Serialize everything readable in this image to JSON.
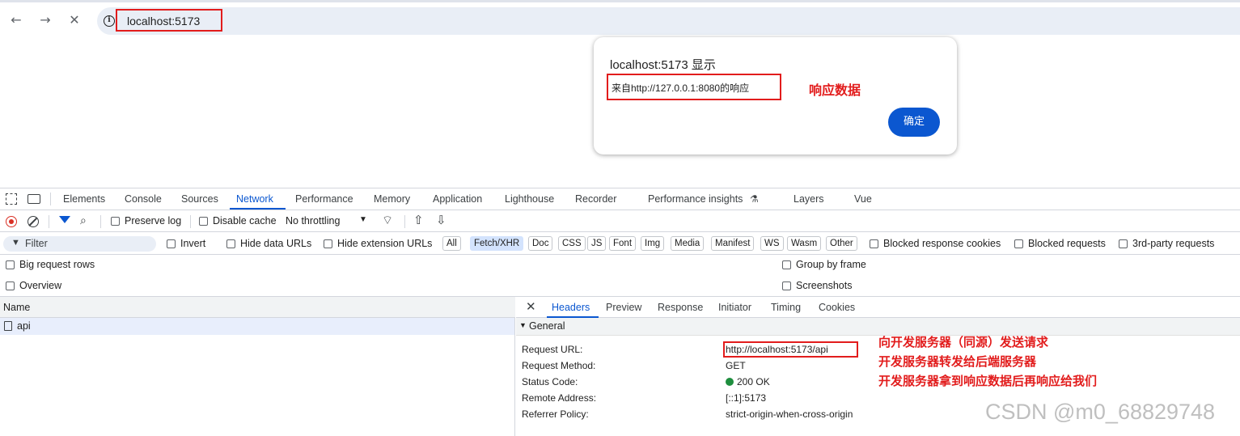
{
  "browser": {
    "url": "localhost:5173",
    "nav": {
      "back": "←",
      "forward": "→",
      "stop": "✕"
    }
  },
  "dialog": {
    "title": "localhost:5173 显示",
    "message": "来自http://127.0.0.1:8080的响应",
    "ok_label": "确定",
    "annotation": "响应数据"
  },
  "devtools": {
    "tabs": [
      "Elements",
      "Console",
      "Sources",
      "Network",
      "Performance",
      "Memory",
      "Application",
      "Lighthouse",
      "Recorder",
      "Performance insights",
      "Layers",
      "Vue"
    ],
    "active_tab": "Network",
    "toolbar": {
      "preserve_log": "Preserve log",
      "disable_cache": "Disable cache",
      "throttling": "No throttling"
    },
    "filter": {
      "placeholder": "Filter",
      "invert": "Invert",
      "hide_data_urls": "Hide data URLs",
      "hide_extension_urls": "Hide extension URLs",
      "chips": [
        "All",
        "Fetch/XHR",
        "Doc",
        "CSS",
        "JS",
        "Font",
        "Img",
        "Media",
        "Manifest",
        "WS",
        "Wasm",
        "Other"
      ],
      "active_chip": "Fetch/XHR",
      "blocked_response_cookies": "Blocked response cookies",
      "blocked_requests": "Blocked requests",
      "third_party": "3rd-party requests"
    },
    "options": {
      "big_request_rows": "Big request rows",
      "overview": "Overview",
      "group_by_frame": "Group by frame",
      "screenshots": "Screenshots"
    },
    "request_list": {
      "header": "Name",
      "rows": [
        "api"
      ]
    },
    "detail": {
      "tabs": [
        "Headers",
        "Preview",
        "Response",
        "Initiator",
        "Timing",
        "Cookies"
      ],
      "active_tab": "Headers",
      "section": "General",
      "rows": [
        {
          "key": "Request URL:",
          "value": "http://localhost:5173/api"
        },
        {
          "key": "Request Method:",
          "value": "GET"
        },
        {
          "key": "Status Code:",
          "value": "200 OK"
        },
        {
          "key": "Remote Address:",
          "value": "[::1]:5173"
        },
        {
          "key": "Referrer Policy:",
          "value": "strict-origin-when-cross-origin"
        }
      ],
      "annotations": [
        "向开发服务器（同源）发送请求",
        "开发服务器转发给后端服务器",
        "开发服务器拿到响应数据后再响应给我们"
      ]
    }
  },
  "watermark": "CSDN @m0_68829748",
  "colors": {
    "accent": "#0b57d0",
    "annotation": "#e21c1c",
    "status_ok": "#1e8e3e"
  }
}
